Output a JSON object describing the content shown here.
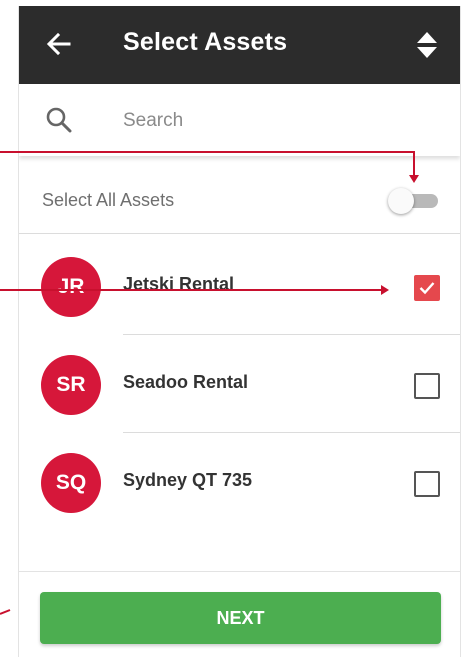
{
  "header": {
    "title": "Select Assets",
    "back_icon": "back-arrow-icon",
    "sort_icon": "sort-icon"
  },
  "search": {
    "placeholder": "Search",
    "icon": "search-icon"
  },
  "select_all": {
    "label": "Select All Assets",
    "enabled": false
  },
  "assets": [
    {
      "initials": "JR",
      "name": "Jetski Rental",
      "checked": true
    },
    {
      "initials": "SR",
      "name": "Seadoo Rental",
      "checked": false
    },
    {
      "initials": "SQ",
      "name": "Sydney QT 735",
      "checked": false
    }
  ],
  "footer": {
    "next_label": "NEXT"
  },
  "colors": {
    "header_bg": "#2c2c2c",
    "avatar": "#d6173a",
    "checkbox_checked": "#e5484d",
    "next_button": "#4cae50",
    "annotation": "#c8102e"
  }
}
